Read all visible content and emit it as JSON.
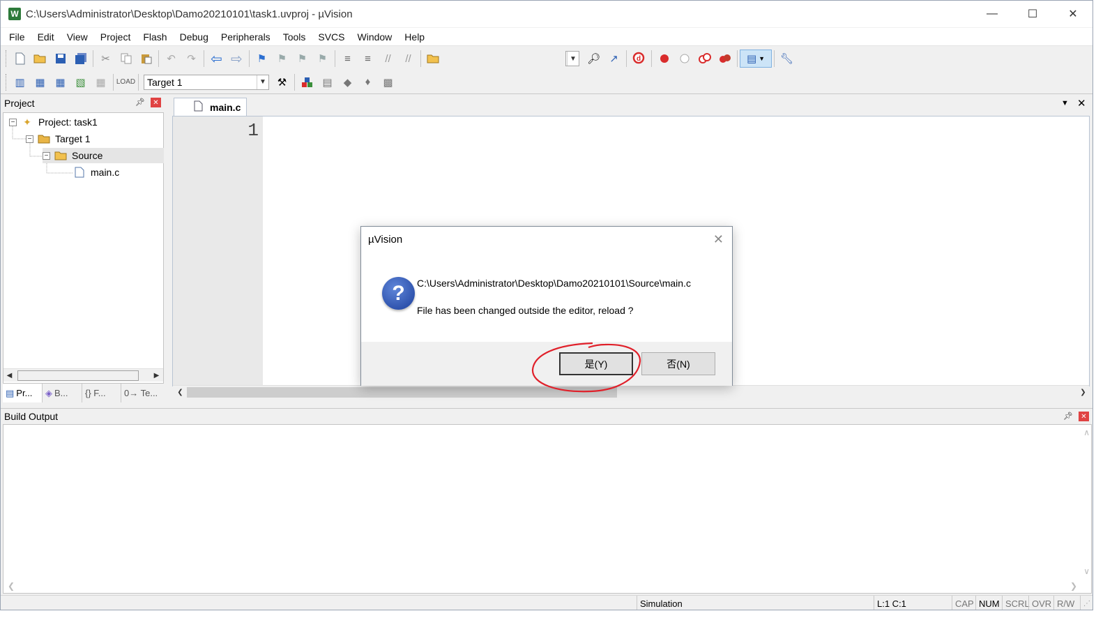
{
  "window": {
    "title": "C:\\Users\\Administrator\\Desktop\\Damo20210101\\task1.uvproj - µVision",
    "app_icon": "W"
  },
  "menu": [
    "File",
    "Edit",
    "View",
    "Project",
    "Flash",
    "Debug",
    "Peripherals",
    "Tools",
    "SVCS",
    "Window",
    "Help"
  ],
  "toolbar2": {
    "target": "Target 1"
  },
  "project_panel": {
    "title": "Project",
    "tree": [
      {
        "label": "Project: task1",
        "icon": "project-icon"
      },
      {
        "label": "Target 1",
        "icon": "target-folder-icon"
      },
      {
        "label": "Source",
        "icon": "folder-icon"
      },
      {
        "label": "main.c",
        "icon": "file-icon"
      }
    ],
    "tabs": [
      "Pr...",
      "B...",
      "{} F...",
      "0→ Te..."
    ]
  },
  "editor": {
    "tab": "main.c",
    "line_number": "1"
  },
  "dialog": {
    "title": "µVision",
    "path": "C:\\Users\\Administrator\\Desktop\\Damo20210101\\Source\\main.c",
    "message": "File has been changed outside the editor, reload ?",
    "yes": "是(Y)",
    "no": "否(N)"
  },
  "build_output": {
    "title": "Build Output"
  },
  "status": {
    "mode": "Simulation",
    "position": "L:1 C:1",
    "keys": [
      "CAP",
      "NUM",
      "SCRL",
      "OVR",
      "R/W"
    ]
  },
  "colors": {
    "accent_red": "#e04343",
    "annotation_circle": "#e0202a",
    "question_blue": "#1c3f9c"
  }
}
